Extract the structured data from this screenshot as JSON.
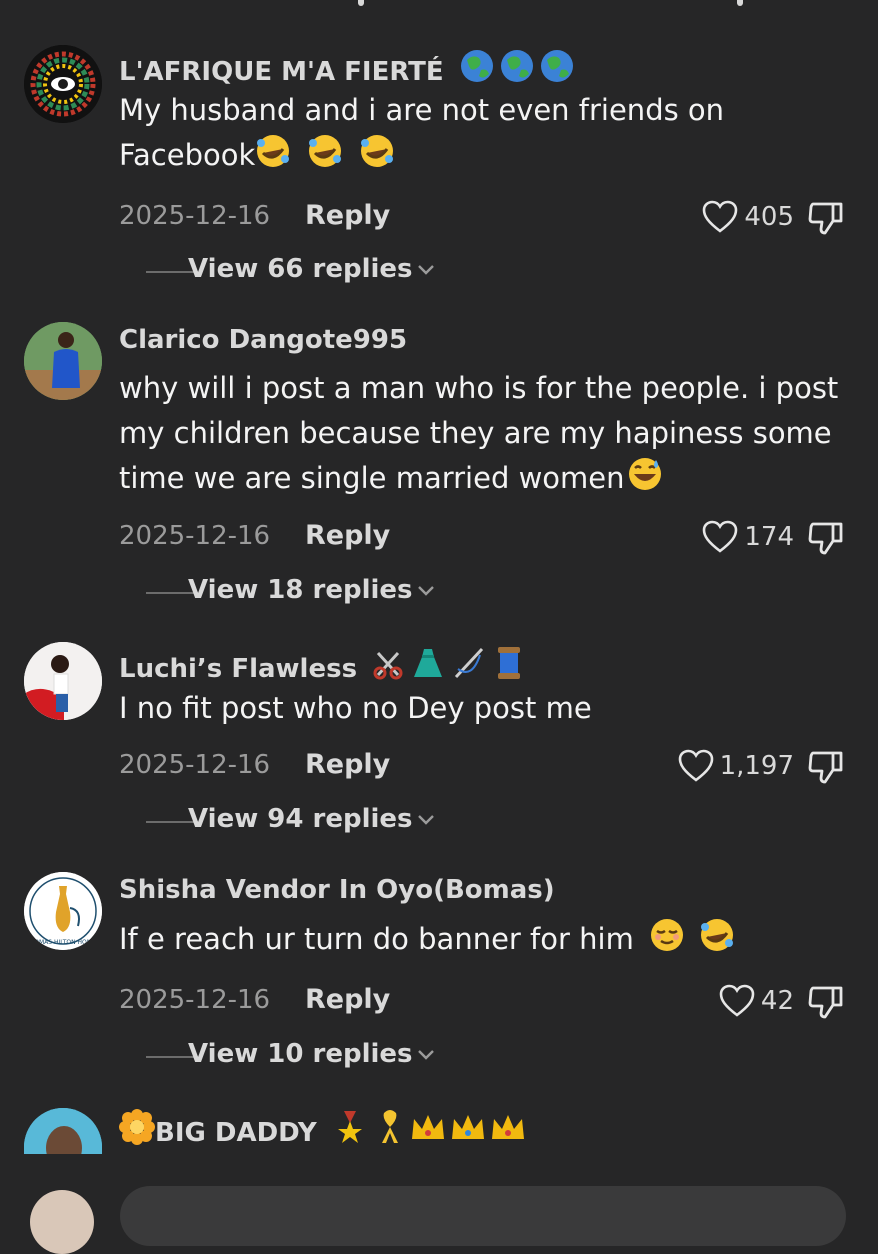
{
  "comments": [
    {
      "username": "L'AFRIQUE M'A FIERTÉ",
      "username_emoji": [
        "globe",
        "globe",
        "globe"
      ],
      "text": "My husband and i are not even friends on Facebook",
      "text_emoji": [
        "rofl",
        "rofl",
        "rofl"
      ],
      "date": "2025-12-16",
      "reply_label": "Reply",
      "likes": "405",
      "view_replies": "View 66 replies"
    },
    {
      "username": "Clarico Dangote995",
      "text": "why will i post a man who is for the people. i post my children because they are my hapiness some time we are single married women",
      "text_emoji": [
        "grin-sweat"
      ],
      "date": "2025-12-16",
      "reply_label": "Reply",
      "likes": "174",
      "view_replies": "View 18 replies"
    },
    {
      "username": "Luchi’s Flawless",
      "username_emoji": [
        "scissors",
        "dress",
        "sewing-needle",
        "thread"
      ],
      "text": "I no fit post who no Dey post me",
      "date": "2025-12-16",
      "reply_label": "Reply",
      "likes": "1,197",
      "view_replies": "View 94 replies"
    },
    {
      "username": "Shisha Vendor In Oyo(Bomas)",
      "text": "If e reach ur turn do banner for him",
      "text_emoji": [
        "relieved",
        "rofl"
      ],
      "date": "2025-12-16",
      "reply_label": "Reply",
      "likes": "42",
      "view_replies": "View 10 replies"
    },
    {
      "username": "BIG DADDY",
      "username_emoji": [
        "rosette",
        "medal",
        "ribbon",
        "crown",
        "crown",
        "crown"
      ]
    }
  ],
  "avatar_logo_text": "BOMAS HILTON HOME",
  "colors": {
    "background": "#262627",
    "primary_text": "#f4f4f4",
    "secondary_text": "#9b9b9b",
    "input_bar": "#3a3a3b"
  },
  "icons": [
    "heart-icon",
    "dislike-icon",
    "chevron-down-icon"
  ]
}
